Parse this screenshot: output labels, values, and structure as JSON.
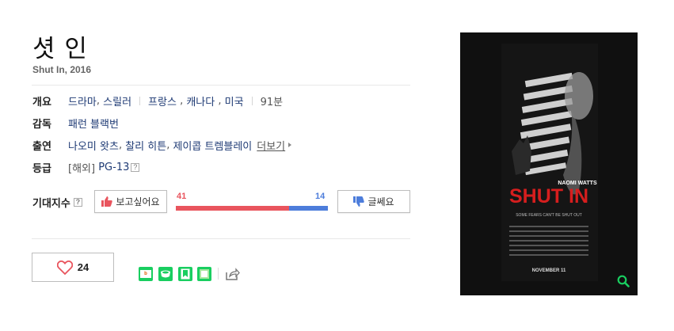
{
  "movie": {
    "title": "셧 인",
    "subtitle": "Shut In, 2016"
  },
  "info": {
    "overview_label": "개요",
    "genres": [
      "드라마",
      "스릴러"
    ],
    "countries": [
      "프랑스",
      "캐나다",
      "미국"
    ],
    "runtime": "91분",
    "director_label": "감독",
    "director": "패런 블랙번",
    "cast_label": "출연",
    "cast": [
      "나오미 왓츠",
      "찰리 히튼",
      "제이콥 트렘블레이"
    ],
    "more_label": "더보기",
    "rating_label": "등급",
    "rating_prefix": "[해외]",
    "rating_value": "PG-13",
    "help_glyph": "?"
  },
  "expectation": {
    "label": "기대지수",
    "want_label": "보고싶어요",
    "dislike_label": "글쎄요",
    "want_count": "41",
    "dislike_count": "14",
    "want_ratio": 0.745
  },
  "like": {
    "count": "24"
  },
  "share": {
    "icons": [
      "blog-icon",
      "cafe-icon",
      "bookmark-icon",
      "memo-icon",
      "share-icon"
    ]
  },
  "poster": {
    "actor": "NAOMI WATTS",
    "title": "SHUT IN",
    "tagline": "SOME FEARS CAN'T BE SHUT OUT",
    "release": "NOVEMBER 11"
  },
  "colors": {
    "like": "#e9555e",
    "dislike": "#4d7ddb",
    "link": "#1e3a74",
    "green": "#19ce60"
  }
}
